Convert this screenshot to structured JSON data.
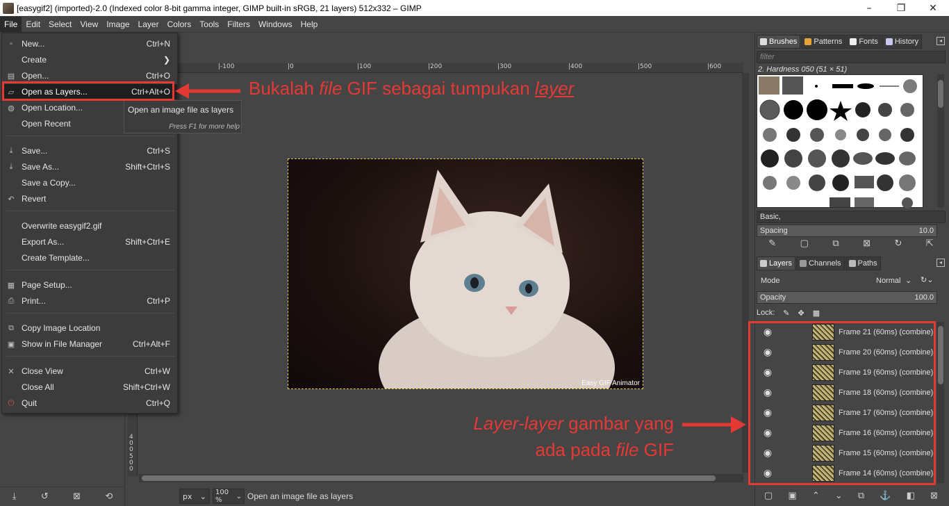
{
  "window": {
    "title": "[easygif2] (imported)-2.0 (Indexed color 8-bit gamma integer, GIMP built-in sRGB, 21 layers) 512x332 – GIMP",
    "buttons": [
      "–",
      "❐",
      "✕"
    ]
  },
  "menubar": [
    "File",
    "Edit",
    "Select",
    "View",
    "Image",
    "Layer",
    "Colors",
    "Tools",
    "Filters",
    "Windows",
    "Help"
  ],
  "file_menu": {
    "new": {
      "label": "New...",
      "shortcut": "Ctrl+N"
    },
    "create": {
      "label": "Create",
      "shortcut": "❯"
    },
    "open": {
      "label": "Open...",
      "shortcut": "Ctrl+O"
    },
    "open_as_layers": {
      "label": "Open as Layers...",
      "shortcut": "Ctrl+Alt+O"
    },
    "open_location": {
      "label": "Open Location..."
    },
    "open_recent": {
      "label": "Open Recent"
    },
    "save": {
      "label": "Save...",
      "shortcut": "Ctrl+S"
    },
    "save_as": {
      "label": "Save As...",
      "shortcut": "Shift+Ctrl+S"
    },
    "save_copy": {
      "label": "Save a Copy..."
    },
    "revert": {
      "label": "Revert"
    },
    "overwrite": {
      "label": "Overwrite easygif2.gif"
    },
    "export_as": {
      "label": "Export As...",
      "shortcut": "Shift+Ctrl+E"
    },
    "create_template": {
      "label": "Create Template..."
    },
    "page_setup": {
      "label": "Page Setup..."
    },
    "print": {
      "label": "Print...",
      "shortcut": "Ctrl+P"
    },
    "copy_location": {
      "label": "Copy Image Location"
    },
    "show_in_manager": {
      "label": "Show in File Manager",
      "shortcut": "Ctrl+Alt+F"
    },
    "close_view": {
      "label": "Close View",
      "shortcut": "Ctrl+W"
    },
    "close_all": {
      "label": "Close All",
      "shortcut": "Shift+Ctrl+W"
    },
    "quit": {
      "label": "Quit",
      "shortcut": "Ctrl+Q"
    }
  },
  "tooltip": {
    "text": "Open an image file as layers",
    "help": "Press F1 for more help"
  },
  "annotations": {
    "top_part1": "Bukalah ",
    "top_italic": "file",
    "top_part2": " GIF sebagai tumpukan ",
    "top_underline": "layer",
    "bottom_italic1": "Layer-layer",
    "bottom_part1": " gambar yang",
    "bottom_part2": "ada pada ",
    "bottom_italic2": "file",
    "bottom_part3": " GIF",
    "color": "#e53935"
  },
  "ruler": {
    "ticks": [
      "|-100",
      "|0",
      "|100",
      "|200",
      "|300",
      "|400",
      "|500",
      "|600"
    ],
    "vertical": [
      "400",
      "500"
    ]
  },
  "canvas": {
    "watermark": "Easy GIF Animator"
  },
  "statusbar": {
    "unit": "px",
    "zoom": "100 %",
    "message": "Open an image file as layers"
  },
  "dock": {
    "tabs_top": [
      "Brushes",
      "Patterns",
      "Fonts",
      "History"
    ],
    "brush_filter_placeholder": "filter",
    "brush_name": "2. Hardness 050 (51 × 51)",
    "brush_tag": "Basic,",
    "spacing_label": "Spacing",
    "spacing_value": "10.0",
    "tabs_bottom": [
      "Layers",
      "Channels",
      "Paths"
    ],
    "mode_label": "Mode",
    "mode_value": "Normal",
    "opacity_label": "Opacity",
    "opacity_value": "100.0",
    "lock_label": "Lock:"
  },
  "layers": [
    "Frame 21 (60ms) (combine)",
    "Frame 20 (60ms) (combine)",
    "Frame 19 (60ms) (combine)",
    "Frame 18 (60ms) (combine)",
    "Frame 17 (60ms) (combine)",
    "Frame 16 (60ms) (combine)",
    "Frame 15 (60ms) (combine)",
    "Frame 14 (60ms) (combine)"
  ]
}
